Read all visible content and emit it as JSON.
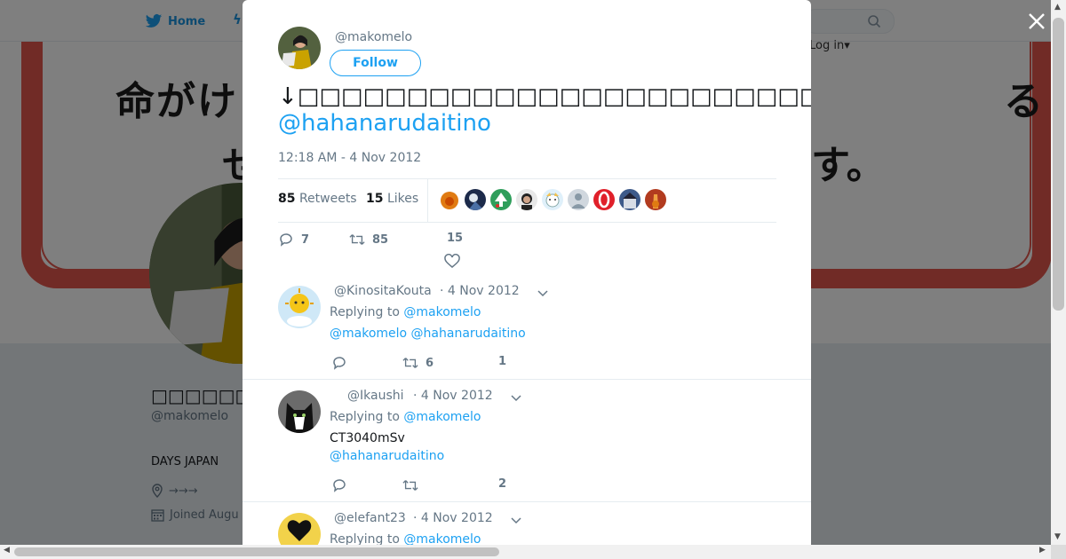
{
  "nav": {
    "home_label": "Home",
    "login_label": "Log in▾"
  },
  "banner": {
    "line1": "命がけ",
    "line2": "せ",
    "line3": "す。",
    "line4": "る"
  },
  "profile": {
    "name": "□□□□□□□",
    "handle": "@makomelo",
    "bio": "DAYS JAPAN",
    "location": "→→→",
    "joined": "Joined Augu"
  },
  "tweet": {
    "author_handle": "@makomelo",
    "follow_label": "Follow",
    "text": "↓□□□□□□□□□□□□□□□□□□□□□□□□□□□□□□□□□□□□□□□□□□□□□□□□□□□□□いるから、□□□□□□□□□□□□",
    "mention": "@hahanarudaitino",
    "timestamp": "12:18 AM - 4 Nov 2012",
    "retweets_count": "85",
    "retweets_label": "Retweets",
    "likes_count": "15",
    "likes_label": "Likes",
    "actions": {
      "replies": "7",
      "retweets": "85",
      "likes": "15"
    }
  },
  "replies": [
    {
      "handle": "@KinositaKouta",
      "date": "· 4 Nov 2012",
      "replying_prefix": "Replying to",
      "replying_to": "@makomelo",
      "text": "@makomelo @hahanarudaitino",
      "text_link": "",
      "replies": "",
      "retweets": "6",
      "likes": "1"
    },
    {
      "handle": "@Ikaushi",
      "date": "· 4 Nov 2012",
      "replying_prefix": "Replying to",
      "replying_to": "@makomelo",
      "text": "CT3040mSv",
      "text_link": "@hahanarudaitino",
      "replies": "",
      "retweets": "",
      "likes": "2"
    },
    {
      "handle": "@elefant23",
      "date": "· 4 Nov 2012",
      "replying_prefix": "Replying to",
      "replying_to": "@makomelo",
      "text": "",
      "text_link": "",
      "replies": "",
      "retweets": "",
      "likes": ""
    }
  ],
  "colors": {
    "accent": "#1da1f2",
    "banner_red": "#e2564c",
    "muted": "#657786"
  }
}
